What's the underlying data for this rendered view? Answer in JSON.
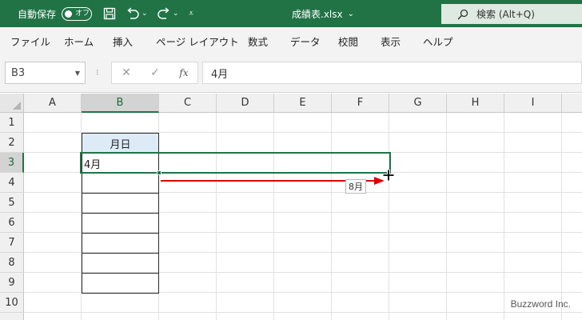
{
  "titlebar": {
    "autosave_label": "自動保存",
    "autosave_toggle": "オフ",
    "file_name": "成績表.xlsx",
    "search_placeholder": "検索 (Alt+Q)",
    "undo_dropdown": "⌄",
    "redo_dropdown": "⌄",
    "qat_more": "⩡",
    "file_chevron": "⌄",
    "icons": [
      "save-icon",
      "undo-icon",
      "redo-icon",
      "search-icon"
    ]
  },
  "ribbon": {
    "tabs": [
      "ファイル",
      "ホーム",
      "挿入",
      "ページ レイアウト",
      "数式",
      "データ",
      "校閲",
      "表示",
      "ヘルプ"
    ]
  },
  "formula_bar": {
    "name_box": "B3",
    "name_box_dropdown": "▼",
    "separator": "⁝",
    "cancel": "✕",
    "enter": "✓",
    "fx": "fx",
    "value": "4月"
  },
  "sheet": {
    "columns": [
      "A",
      "B",
      "C",
      "D",
      "E",
      "F",
      "G",
      "H",
      "I"
    ],
    "rows": [
      "1",
      "2",
      "3",
      "4",
      "5",
      "6",
      "7",
      "8",
      "9",
      "10"
    ],
    "selected_column": "B",
    "selected_row": "3",
    "cells": {
      "B2": "月日",
      "B3": "4月"
    },
    "header_fill": "#DDEBF7",
    "fill_tooltip": "8月",
    "fill_arrow_color": "#E00000"
  },
  "watermark": "Buzzword Inc.",
  "colors": {
    "excel_green": "#217346",
    "ribbon_bg": "#F3F3F3"
  }
}
